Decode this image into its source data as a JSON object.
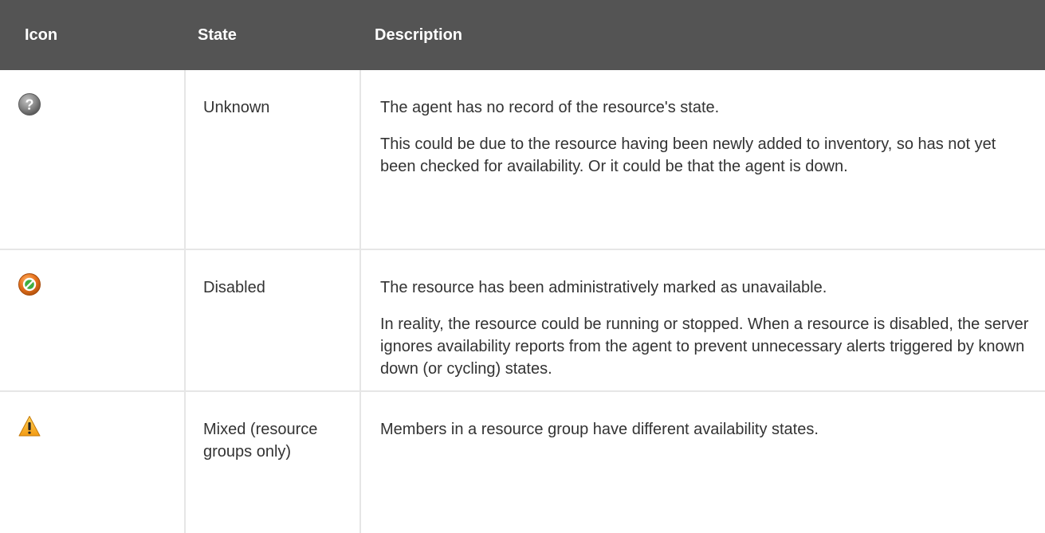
{
  "table": {
    "headers": {
      "icon": "Icon",
      "state": "State",
      "description": "Description"
    },
    "rows": [
      {
        "icon": "unknown-question-icon",
        "icon_color": "#7a7a7a",
        "state": "Unknown",
        "description": [
          "The agent has no record of the resource's state.",
          "This could be due to the resource having been newly added to inventory, so has not yet been checked for availability. Or it could be that the agent is down."
        ]
      },
      {
        "icon": "disabled-slash-icon",
        "icon_color": "#e8731e",
        "state": "Disabled",
        "description": [
          "The resource has been administratively marked as unavailable.",
          "In reality, the resource could be running or stopped. When a resource is disabled, the server ignores availability reports from the agent to prevent unnecessary alerts triggered by known down (or cycling) states."
        ]
      },
      {
        "icon": "warning-triangle-icon",
        "icon_color": "#f5a623",
        "state": "Mixed (resource groups only)",
        "description": [
          "Members in a resource group have different availability states."
        ]
      }
    ]
  }
}
